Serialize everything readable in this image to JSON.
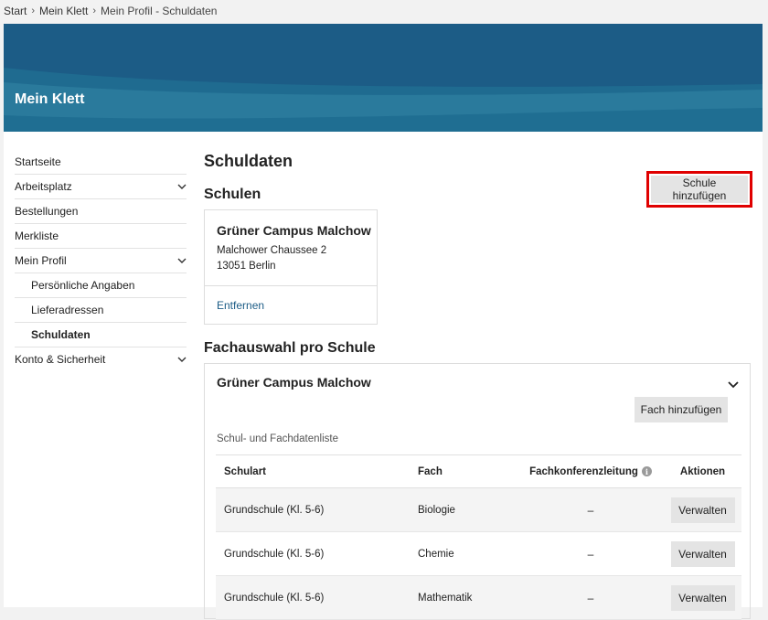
{
  "breadcrumb": {
    "items": [
      "Start",
      "Mein Klett",
      "Mein Profil - Schuldaten"
    ]
  },
  "hero": {
    "title": "Mein Klett"
  },
  "sidebar": {
    "items": [
      {
        "label": "Startseite"
      },
      {
        "label": "Arbeitsplatz"
      },
      {
        "label": "Bestellungen"
      },
      {
        "label": "Merkliste"
      },
      {
        "label": "Mein Profil"
      },
      {
        "label": "Persönliche Angaben"
      },
      {
        "label": "Lieferadressen"
      },
      {
        "label": "Schuldaten"
      },
      {
        "label": "Konto & Sicherheit"
      }
    ]
  },
  "main": {
    "page_title": "Schuldaten",
    "schools_title": "Schulen",
    "add_school_label": "Schule hinzufügen",
    "school_card": {
      "name": "Grüner Campus Malchow",
      "street": "Malchower Chaussee 2",
      "city": "13051 Berlin",
      "remove_label": "Entfernen"
    },
    "fach_title": "Fachauswahl pro Schule",
    "fach": {
      "school_name": "Grüner Campus Malchow",
      "add_fach_label": "Fach hinzufügen",
      "list_label": "Schul- und Fachdatenliste",
      "columns": [
        "Schulart",
        "Fach",
        "Fachkonferenzleitung",
        "Aktionen"
      ],
      "rows": [
        {
          "schulart": "Grundschule (Kl. 5-6)",
          "fach": "Biologie",
          "leitung": "–",
          "action": "Verwalten"
        },
        {
          "schulart": "Grundschule (Kl. 5-6)",
          "fach": "Chemie",
          "leitung": "–",
          "action": "Verwalten"
        },
        {
          "schulart": "Grundschule (Kl. 5-6)",
          "fach": "Mathematik",
          "leitung": "–",
          "action": "Verwalten"
        }
      ]
    }
  }
}
